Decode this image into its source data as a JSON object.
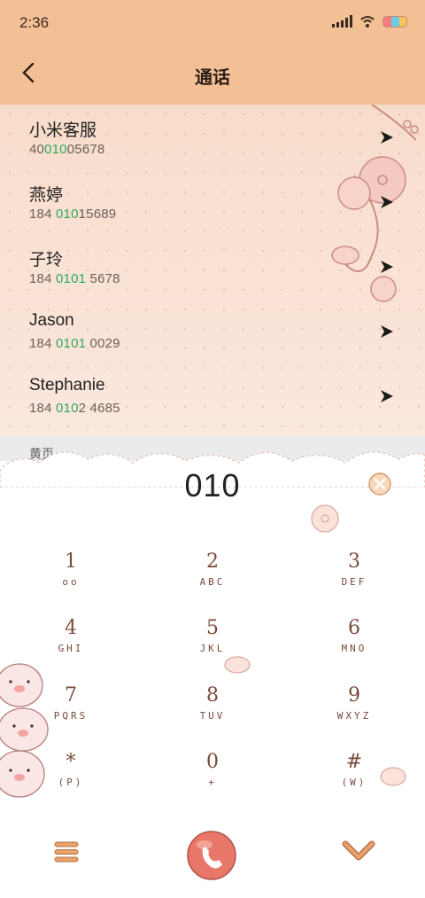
{
  "status_bar": {
    "time": "2:36"
  },
  "header": {
    "title": "通话"
  },
  "contacts": [
    {
      "name": "小米客服",
      "number_pre": "40",
      "number_hl": "010",
      "number_post": "05678"
    },
    {
      "name": "燕婷",
      "number_pre": "184 ",
      "number_hl": "010",
      "number_post": "15689"
    },
    {
      "name": "子玲",
      "number_pre": "184 ",
      "number_hl": "0101",
      "number_post": " 5678"
    },
    {
      "name": "Jason",
      "number_pre": "184 ",
      "number_hl": "0101",
      "number_post": " 0029"
    },
    {
      "name": "Stephanie",
      "number_pre": "184 ",
      "number_hl": "010",
      "number_post": "2 4685"
    }
  ],
  "yellow_pages": {
    "label": "黄页"
  },
  "dialer": {
    "input": "010",
    "keys": [
      {
        "digit": "1",
        "letters": "oo"
      },
      {
        "digit": "2",
        "letters": "ABC"
      },
      {
        "digit": "3",
        "letters": "DEF"
      },
      {
        "digit": "4",
        "letters": "GHI"
      },
      {
        "digit": "5",
        "letters": "JKL"
      },
      {
        "digit": "6",
        "letters": "MNO"
      },
      {
        "digit": "7",
        "letters": "PQRS"
      },
      {
        "digit": "8",
        "letters": "TUV"
      },
      {
        "digit": "9",
        "letters": "WXYZ"
      },
      {
        "digit": "*",
        "letters": "(P)"
      },
      {
        "digit": "0",
        "letters": "+"
      },
      {
        "digit": "#",
        "letters": "(W)"
      }
    ]
  },
  "colors": {
    "header": "#f3bf94",
    "highlight": "#2daa5f",
    "call": "#e8776a"
  }
}
